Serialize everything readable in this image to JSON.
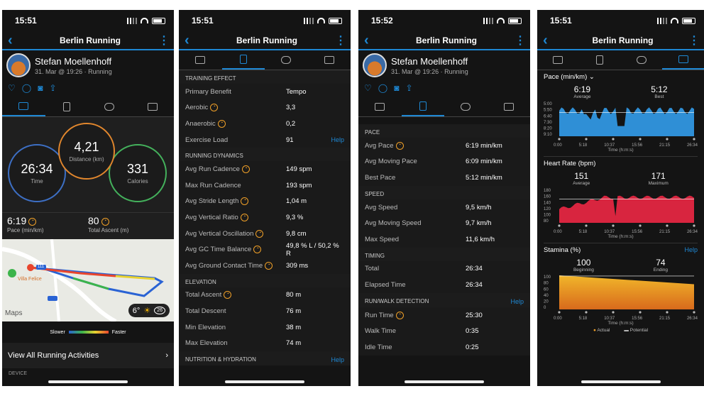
{
  "status": {
    "time1": "15:51",
    "time2": "15:51",
    "time3": "15:52",
    "time4": "15:51"
  },
  "nav": {
    "title": "Berlin Running"
  },
  "profile": {
    "name": "Stefan Moellenhoff",
    "sub": "31. Mar @ 19:26 · Running"
  },
  "summary": {
    "time": "26:34",
    "time_label": "Time",
    "distance": "4,21",
    "distance_label": "Distance (km)",
    "calories": "331",
    "calories_label": "Calories",
    "pace": "6:19",
    "pace_label": "Pace (min/km)",
    "ascent": "80",
    "ascent_label": "Total Ascent (m)"
  },
  "map": {
    "logo": "Maps",
    "temp": "6°",
    "badge": "26",
    "place": "Villa Felice",
    "road": "111"
  },
  "legend": {
    "slower": "Slower",
    "faster": "Faster"
  },
  "view_all": "View All Running Activities",
  "device_label": "DEVICE",
  "training": {
    "section": "TRAINING EFFECT",
    "rows": [
      {
        "k": "Primary Benefit",
        "v": "Tempo"
      },
      {
        "k": "Aerobic",
        "v": "3,3"
      },
      {
        "k": "Anaerobic",
        "v": "0,2"
      },
      {
        "k": "Exercise Load",
        "v": "91"
      }
    ],
    "help": "Help"
  },
  "dynamics": {
    "section": "RUNNING DYNAMICS",
    "rows": [
      {
        "k": "Avg Run Cadence",
        "v": "149 spm"
      },
      {
        "k": "Max Run Cadence",
        "v": "193 spm"
      },
      {
        "k": "Avg Stride Length",
        "v": "1,04 m"
      },
      {
        "k": "Avg Vertical Ratio",
        "v": "9,3 %"
      },
      {
        "k": "Avg Vertical Oscillation",
        "v": "9,8 cm"
      },
      {
        "k": "Avg GC Time Balance",
        "v": "49,8 % L / 50,2 % R"
      },
      {
        "k": "Avg Ground Contact Time",
        "v": "309 ms"
      }
    ]
  },
  "elevation": {
    "section": "ELEVATION",
    "rows": [
      {
        "k": "Total Ascent",
        "v": "80 m"
      },
      {
        "k": "Total Descent",
        "v": "76 m"
      },
      {
        "k": "Min Elevation",
        "v": "38 m"
      },
      {
        "k": "Max Elevation",
        "v": "74 m"
      }
    ]
  },
  "nutrition": {
    "section": "NUTRITION & HYDRATION",
    "help": "Help"
  },
  "pace": {
    "section": "PACE",
    "rows": [
      {
        "k": "Avg Pace",
        "v": "6:19 min/km"
      },
      {
        "k": "Avg Moving Pace",
        "v": "6:09 min/km"
      },
      {
        "k": "Best Pace",
        "v": "5:12 min/km"
      }
    ]
  },
  "speed": {
    "section": "SPEED",
    "rows": [
      {
        "k": "Avg Speed",
        "v": "9,5 km/h"
      },
      {
        "k": "Avg Moving Speed",
        "v": "9,7 km/h"
      },
      {
        "k": "Max Speed",
        "v": "11,6 km/h"
      }
    ]
  },
  "timing": {
    "section": "TIMING",
    "rows": [
      {
        "k": "Total",
        "v": "26:34"
      },
      {
        "k": "Elapsed Time",
        "v": "26:34"
      }
    ]
  },
  "runwalk": {
    "section": "RUN/WALK DETECTION",
    "help": "Help",
    "rows": [
      {
        "k": "Run Time",
        "v": "25:30"
      },
      {
        "k": "Walk Time",
        "v": "0:35"
      },
      {
        "k": "Idle Time",
        "v": "0:25"
      }
    ]
  },
  "chart_data": [
    {
      "type": "area",
      "title": "Pace (min/km)",
      "xlabel": "Time (h:m:s)",
      "x_ticks": [
        "0:00",
        "5:18",
        "10:37",
        "15:56",
        "21:15",
        "26:34"
      ],
      "y_ticks": [
        "5:00",
        "5:50",
        "6:40",
        "7:30",
        "8:20",
        "9:10"
      ],
      "summary": [
        {
          "label": "Average",
          "value": "6:19"
        },
        {
          "label": "Best",
          "value": "5:12"
        }
      ],
      "color": "#2f8fd6"
    },
    {
      "type": "area",
      "title": "Heart Rate (bpm)",
      "xlabel": "Time (h:m:s)",
      "x_ticks": [
        "0:00",
        "5:18",
        "10:37",
        "15:56",
        "21:15",
        "26:34"
      ],
      "y_ticks": [
        "180",
        "160",
        "140",
        "120",
        "100",
        "80"
      ],
      "summary": [
        {
          "label": "Average",
          "value": "151"
        },
        {
          "label": "Maximum",
          "value": "171"
        }
      ],
      "color": "#d8253f"
    },
    {
      "type": "area",
      "title": "Stamina (%)",
      "help": "Help",
      "xlabel": "Time (h:m:s)",
      "x_ticks": [
        "0:00",
        "5:18",
        "10:37",
        "15:56",
        "21:15",
        "26:34"
      ],
      "y_ticks": [
        "100",
        "80",
        "60",
        "40",
        "20",
        "0"
      ],
      "summary": [
        {
          "label": "Beginning",
          "value": "100"
        },
        {
          "label": "Ending",
          "value": "74"
        }
      ],
      "legend": [
        "Actual",
        "Potential"
      ],
      "color": "#e29b22"
    }
  ]
}
